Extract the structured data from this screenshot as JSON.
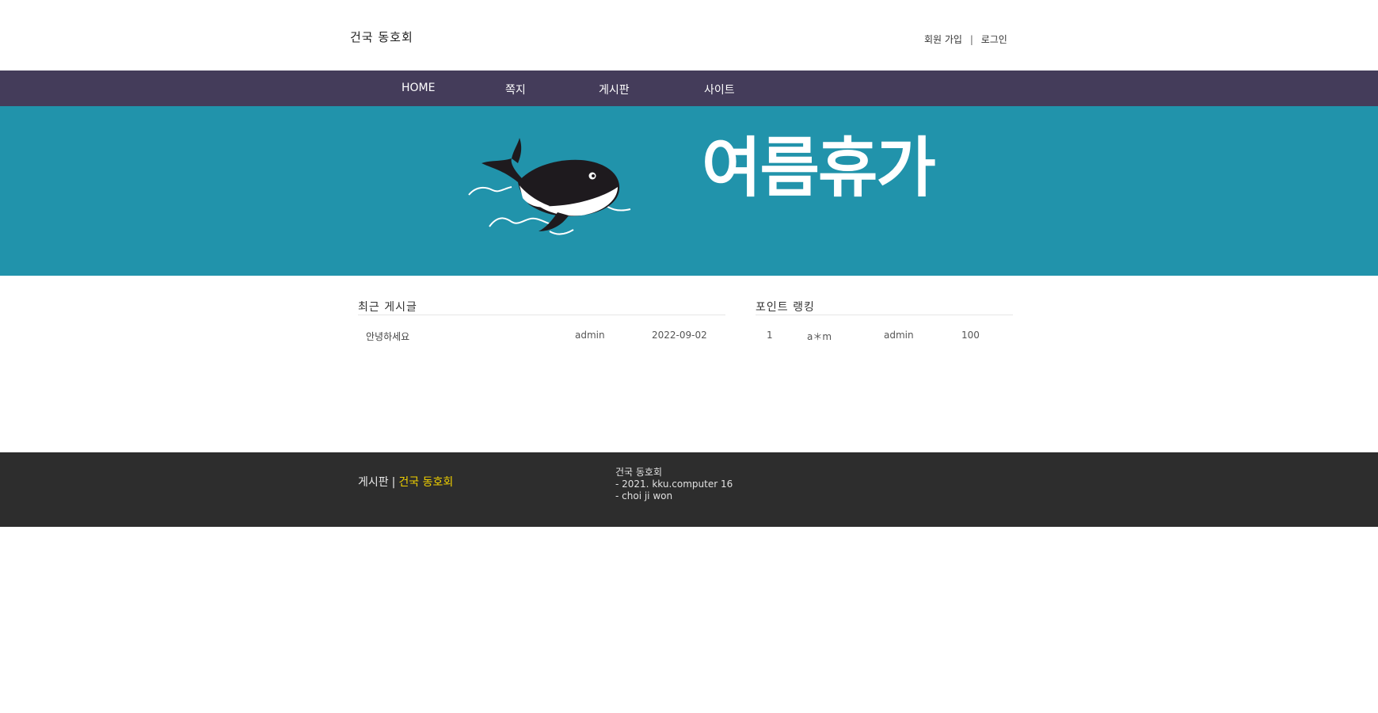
{
  "header": {
    "site_title": "건국 동호회",
    "signup": "회원 가입",
    "separator": "|",
    "login": "로그인"
  },
  "nav": {
    "items": [
      {
        "label": "HOME"
      },
      {
        "label": "쪽지"
      },
      {
        "label": "게시판"
      },
      {
        "label": "사이트"
      }
    ]
  },
  "banner": {
    "title": "여름휴가",
    "colors": {
      "background": "#2193ab",
      "whale": "#1e1a1e",
      "text": "#ffffff"
    },
    "icon": "whale-illustration"
  },
  "recent_posts": {
    "title": "최근 게시글",
    "rows": [
      {
        "subject": "안녕하세요",
        "author": "admin",
        "date": "2022-09-02"
      }
    ]
  },
  "point_ranking": {
    "title": "포인트 랭킹",
    "rows": [
      {
        "rank": "1",
        "nickname": "a＊m",
        "user": "admin",
        "points": "100"
      }
    ]
  },
  "footer": {
    "board_link": "게시판",
    "separator": "|",
    "club_link": "건국 동호회",
    "info_lines": [
      "건국 동호회",
      "- 2021. kku.computer 16",
      "- choi ji won"
    ],
    "accent_color": "#f0d000"
  },
  "colors": {
    "nav_bg": "#443c5a",
    "footer_bg": "#2d2d2d"
  }
}
